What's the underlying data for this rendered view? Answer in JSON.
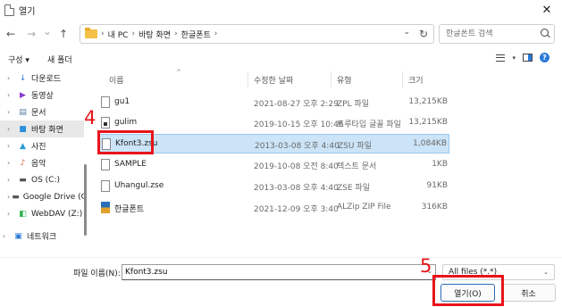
{
  "window": {
    "title": "열기",
    "close_glyph": "✕"
  },
  "nav": {
    "back_glyph": "←",
    "forward_glyph": "→",
    "recent_glyph": "⌄",
    "up_glyph": "↑",
    "breadcrumb": [
      "내 PC",
      "바탕 화면",
      "한글폰트"
    ],
    "crumb_sep": "›",
    "refresh_glyph": "↻",
    "search_placeholder": "한글폰트 검색"
  },
  "toolbar": {
    "organize": "구성 ▾",
    "new_folder": "새 폴더"
  },
  "sidebar": {
    "items": [
      {
        "label": "다운로드",
        "icon": "download-icon",
        "glyph": "↓",
        "color": "#2a7bd8"
      },
      {
        "label": "동영상",
        "icon": "video-icon",
        "glyph": "▶",
        "color": "#8a3dcc"
      },
      {
        "label": "문서",
        "icon": "documents-icon",
        "glyph": "▤",
        "color": "#5b7fa6"
      },
      {
        "label": "바탕 화면",
        "icon": "desktop-icon",
        "glyph": "■",
        "color": "#2a8fd8"
      },
      {
        "label": "사진",
        "icon": "pictures-icon",
        "glyph": "▲",
        "color": "#2a9bd8"
      },
      {
        "label": "음악",
        "icon": "music-icon",
        "glyph": "♪",
        "color": "#e25a2a"
      },
      {
        "label": "OS (C:)",
        "icon": "drive-icon",
        "glyph": "▬",
        "color": "#555555"
      },
      {
        "label": "Google Drive (G",
        "icon": "drive-icon",
        "glyph": "▬",
        "color": "#555555"
      },
      {
        "label": "WebDAV (Z:)",
        "icon": "network-drive-icon",
        "glyph": "◧",
        "color": "#2ab04a"
      },
      {
        "label": "네트워크",
        "icon": "network-icon",
        "glyph": "▣",
        "color": "#2a7bd8"
      }
    ]
  },
  "columns": {
    "name": "이름",
    "modified": "수정한 날짜",
    "type": "유형",
    "size": "크기",
    "sort_glyph": "^"
  },
  "files": [
    {
      "name": "gu1",
      "date": "2021-08-27 오후 2:29",
      "type": "ZPL 파일",
      "size": "13,215KB",
      "icon": "file-icon"
    },
    {
      "name": "gulim",
      "date": "2019-10-15 오후 10:46",
      "type": "트루타입 글꼴 파일",
      "size": "13,215KB",
      "icon": "font-file-icon"
    },
    {
      "name": "Kfont3.zsu",
      "date": "2013-03-08 오후 4:40",
      "type": "ZSU 파일",
      "size": "1,084KB",
      "icon": "file-icon"
    },
    {
      "name": "SAMPLE",
      "date": "2019-10-08 오전 8:40",
      "type": "텍스트 문서",
      "size": "1KB",
      "icon": "text-file-icon"
    },
    {
      "name": "Uhangul.zse",
      "date": "2013-03-08 오후 4:40",
      "type": "ZSE 파일",
      "size": "91KB",
      "icon": "file-icon"
    },
    {
      "name": "한글폰트",
      "date": "2021-12-09 오후 3:40",
      "type": "ALZip ZIP File",
      "size": "316KB",
      "icon": "zip-file-icon"
    }
  ],
  "bottom": {
    "filename_label": "파일 이름(N):",
    "filename_value": "Kfont3.zsu",
    "filetype_value": "All files (*.*)",
    "chev_glyph": "⌄",
    "open_label": "열기(O)",
    "cancel_label": "취소"
  },
  "annotations": {
    "step4": "4",
    "step5": "5",
    "color": "#e8141a"
  }
}
